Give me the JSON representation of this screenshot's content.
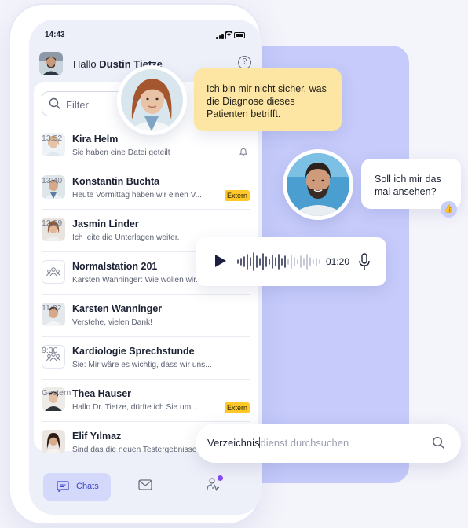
{
  "status_bar": {
    "time": "14:43"
  },
  "header": {
    "greeting": "Hallo",
    "user_name": "Dustin Tietze",
    "help_icon": "question-circle-icon"
  },
  "filter": {
    "placeholder": "Filter"
  },
  "chats": [
    {
      "name": "Kira Helm",
      "message": "Sie haben eine Datei geteilt",
      "time": "13:52",
      "badge": "",
      "icon": "bell-icon"
    },
    {
      "name": "Konstantin Buchta",
      "message": "Heute Vormittag haben wir einen V...",
      "time": "13:40",
      "badge": "Extern"
    },
    {
      "name": "Jasmin Linder",
      "message": "Ich leite die Unterlagen weiter.",
      "time": "12:59",
      "badge": ""
    },
    {
      "name": "Normalstation 201",
      "message": "Karsten Wanninger: Wie wollen wir...",
      "time": "",
      "badge": ""
    },
    {
      "name": "Karsten Wanninger",
      "message": "Verstehe, vielen Dank!",
      "time": "11:22",
      "badge": ""
    },
    {
      "name": "Kardiologie Sprechstunde",
      "message": "Sie: Mir wäre es wichtig, dass wir uns...",
      "time": "9:30",
      "badge": ""
    },
    {
      "name": "Thea Hauser",
      "message": "Hallo Dr. Tietze, dürfte ich Sie um...",
      "time": "Gestern",
      "badge": "Extern"
    },
    {
      "name": "Elif Yılmaz",
      "message": "Sind das die neuen Testergebnisse?",
      "time": "",
      "badge": ""
    }
  ],
  "tabbar": {
    "chats_label": "Chats"
  },
  "bubbles": {
    "doctor_message": "Ich bin mir nicht sicher, was die Diagnose dieses Patienten betrifft.",
    "colleague_reply": "Soll ich mir das mal ansehen?",
    "reaction": "👍"
  },
  "voice_message": {
    "duration": "01:20"
  },
  "directory_search": {
    "typed": "Verzeichnis",
    "placeholder_rest": "dienst durchsuchen"
  },
  "colors": {
    "accent": "#3a46c8",
    "badge": "#ffc727",
    "bubble_yellow": "#fde6a3",
    "panel": "#c6cbfb"
  }
}
